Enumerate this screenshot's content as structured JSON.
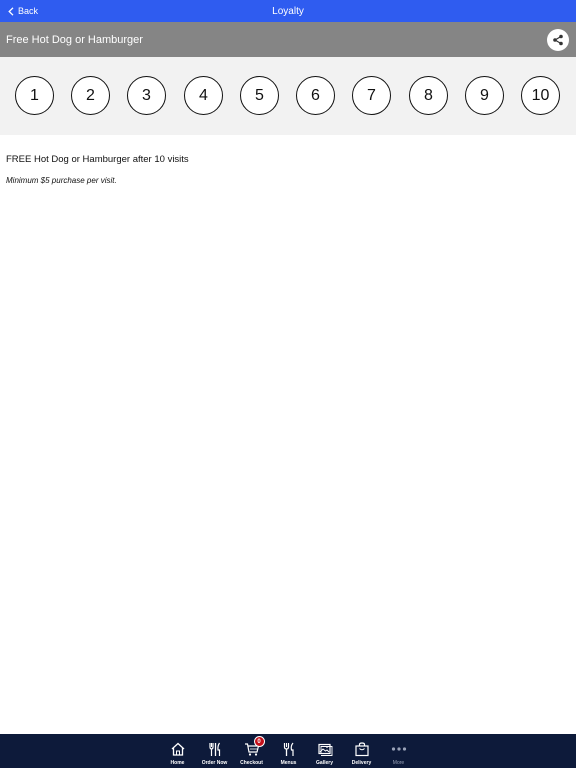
{
  "nav": {
    "back_label": "Back",
    "title": "Loyalty"
  },
  "header": {
    "title": "Free Hot Dog or Hamburger"
  },
  "punch_card": {
    "stamps": [
      "1",
      "2",
      "3",
      "4",
      "5",
      "6",
      "7",
      "8",
      "9",
      "10"
    ]
  },
  "content": {
    "description": "FREE Hot Dog or Hamburger after 10 visits",
    "note": "Minimum $5 purchase per visit."
  },
  "tabbar": {
    "items": [
      {
        "label": "Home",
        "icon": "home-icon"
      },
      {
        "label": "Order Now",
        "icon": "utensils-icon"
      },
      {
        "label": "Checkout",
        "icon": "cart-icon",
        "badge": "0"
      },
      {
        "label": "Menus",
        "icon": "fork-knife-icon"
      },
      {
        "label": "Gallery",
        "icon": "gallery-icon"
      },
      {
        "label": "Delivery",
        "icon": "bag-icon"
      },
      {
        "label": "More",
        "icon": "more-dots-icon"
      }
    ]
  },
  "colors": {
    "nav_bg": "#2f5cf0",
    "header_bg": "#858585",
    "card_bg": "#f2f2f2",
    "tabbar_bg": "#0d1a3a",
    "badge": "#c4101a"
  }
}
